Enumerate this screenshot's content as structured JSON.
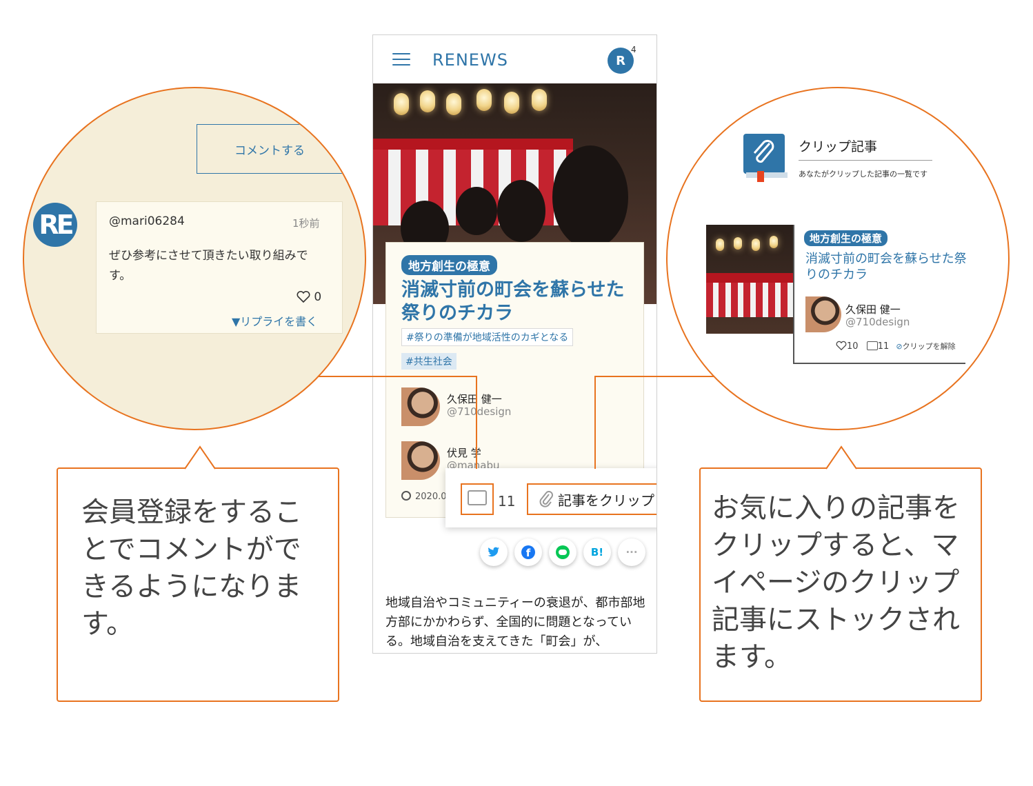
{
  "phone": {
    "logo": "RENEWS",
    "notification_count": "4",
    "avatar_letter": "R",
    "article": {
      "category": "地方創生の極意",
      "title": "消滅寸前の町会を蘇らせた祭りのチカラ",
      "tags": [
        "#祭りの準備が地域活性のカギとなる",
        "#共生社会"
      ],
      "authors": [
        {
          "name": "久保田 健一",
          "handle": "@710design"
        },
        {
          "name": "伏見 学",
          "handle": "@manabu"
        }
      ],
      "date": "2020.0"
    },
    "actions": {
      "comment_count": "11",
      "clip_label": "記事をクリップ"
    },
    "share_buttons": [
      "twitter-icon",
      "facebook-icon",
      "line-icon",
      "hatena-icon",
      "more-icon"
    ],
    "share_labels": {
      "hatena": "B!",
      "more": "···"
    },
    "body_text": "地域自治やコミュニティーの衰退が、都市部地方部にかかわらず、全国的に問題となっている。地域自治を支えてきた「町会」が、"
  },
  "left_zoom": {
    "submit_label": "コメントする",
    "comment": {
      "user": "@mari06284",
      "time": "1秒前",
      "text": "ぜひ参考にさせて頂きたい取り組みです。",
      "likes": "0",
      "reply_label": "▼リプライを書く"
    }
  },
  "right_zoom": {
    "heading": "クリップ記事",
    "subheading": "あなたがクリップした記事の一覧です",
    "article": {
      "category": "地方創生の極意",
      "title": "消滅寸前の町会を蘇らせた祭りのチカラ",
      "author": {
        "name": "久保田 健一",
        "handle": "@710design"
      },
      "likes": "10",
      "comments": "11",
      "unclip_label": "クリップを解除"
    }
  },
  "callouts": {
    "left": "会員登録をすることでコメントができるようになります。",
    "right": "お気に入りの記事をクリップすると、マイページのクリップ記事にストックされます。"
  },
  "colors": {
    "accent": "#e8731f",
    "brand": "#2f75a8",
    "zoom_bg": "#f5eed9"
  }
}
